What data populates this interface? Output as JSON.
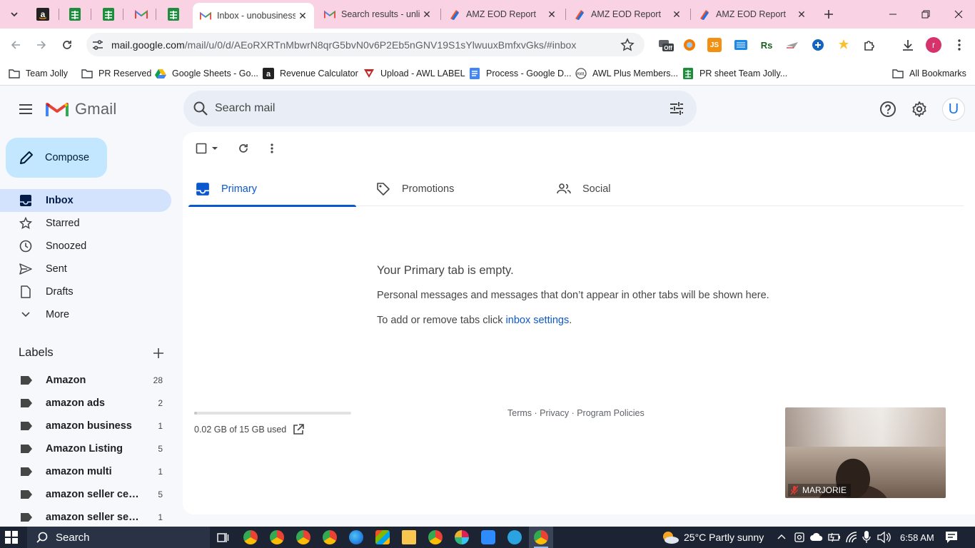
{
  "browser": {
    "tabs": [
      {
        "title": "Inbox - unobusiness@gmail.com",
        "active": true
      },
      {
        "title": "Search results - unlisted",
        "active": false
      },
      {
        "title": "AMZ EOD Report",
        "active": false
      },
      {
        "title": "AMZ EOD Report",
        "active": false
      },
      {
        "title": "AMZ EOD Report",
        "active": false
      }
    ],
    "url_host": "mail.google.com",
    "url_path": "/mail/u/0/d/AEoRXRTnMbwrN8qrG5bvN0v6P2Eb5nGNV19S1sYlwuuxBmfxvGks/#inbox",
    "profile_initial": "r",
    "extensions": {
      "jsx": "JS",
      "rs": "Rs"
    },
    "bookmarks": [
      "Team Jolly",
      "PR Reserved",
      "Google Sheets - Go...",
      "Revenue Calculator",
      "Upload - AWL LABEL",
      "Process - Google D...",
      "AWL Plus Members...",
      "PR sheet Team Jolly..."
    ],
    "all_bookmarks": "All Bookmarks"
  },
  "gmail": {
    "brand": "Gmail",
    "search_placeholder": "Search mail",
    "avatar_initial": "U",
    "compose": "Compose",
    "nav": [
      "Inbox",
      "Starred",
      "Snoozed",
      "Sent",
      "Drafts",
      "More"
    ],
    "labels_title": "Labels",
    "labels": [
      {
        "name": "Amazon",
        "count": "28"
      },
      {
        "name": "amazon ads",
        "count": "2"
      },
      {
        "name": "amazon business",
        "count": "1"
      },
      {
        "name": "Amazon Listing",
        "count": "5"
      },
      {
        "name": "amazon multi",
        "count": "1"
      },
      {
        "name": "amazon seller central",
        "count": "5"
      },
      {
        "name": "amazon seller services",
        "count": "1"
      }
    ],
    "tabs": [
      "Primary",
      "Promotions",
      "Social"
    ],
    "empty": {
      "title": "Your Primary tab is empty.",
      "desc": "Personal messages and messages that don’t appear in other tabs will be shown here.",
      "hint_prefix": "To add or remove tabs click ",
      "hint_link": "inbox settings",
      "hint_suffix": "."
    },
    "storage": {
      "text": "0.02 GB of 15 GB used",
      "used_fraction": 0.0013
    },
    "footer": "Terms · Privacy · Program Policies"
  },
  "video": {
    "name": "MARJORIE"
  },
  "taskbar": {
    "search": "Search",
    "weather": "25°C  Partly sunny",
    "time": "6:58 AM"
  },
  "colors": {
    "accent": "#0b57d0",
    "compose_bg": "#c2e7ff",
    "active_nav": "#d3e3fd",
    "tabstrip": "#f9d2e4"
  }
}
